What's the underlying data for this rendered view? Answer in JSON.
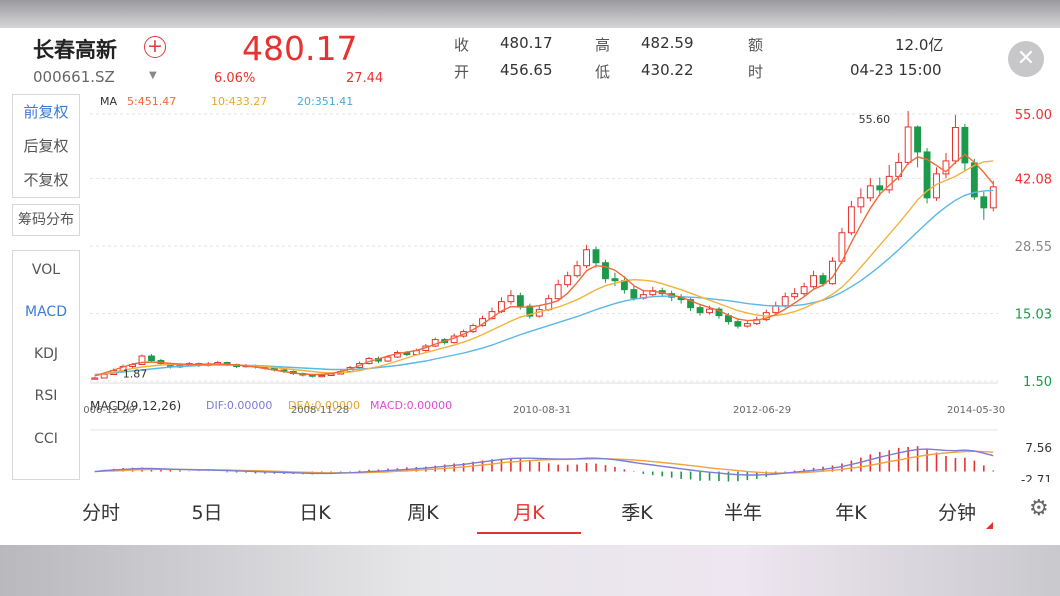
{
  "header": {
    "name": "长春高新",
    "code": "000661.SZ",
    "price": "480.17",
    "change_pct": "6.06%",
    "change_amt": "27.44",
    "quote": {
      "close_label": "收",
      "close": "480.17",
      "open_label": "开",
      "open": "456.65",
      "high_label": "高",
      "high": "482.59",
      "low_label": "低",
      "low": "430.22",
      "amount_label": "额",
      "amount": "12.0亿",
      "time_label": "时",
      "time": "04-23 15:00"
    }
  },
  "rights": [
    "前复权",
    "后复权",
    "不复权"
  ],
  "chip_label": "筹码分布",
  "indicators": [
    "VOL",
    "MACD",
    "KDJ",
    "RSI",
    "CCI"
  ],
  "ma": {
    "label": "MA",
    "ma5": "5:451.47",
    "ma10": "10:433.27",
    "ma20": "20:351.41"
  },
  "macd": {
    "label": "MACD(9,12,26)",
    "dif": "DIF:0.00000",
    "dea": "DEA:0.00000",
    "macd": "MACD:0.00000"
  },
  "tabs": [
    "分时",
    "5日",
    "日K",
    "周K",
    "月K",
    "季K",
    "半年",
    "年K",
    "分钟"
  ],
  "colors": {
    "up": "#e8322f",
    "down": "#1a9a4a",
    "ma5": "#f06a3a",
    "ma10": "#f2b23c",
    "ma20": "#5ab8e6",
    "dif": "#7b7bd8",
    "dea": "#f2a33c",
    "macd": "#e04ad8",
    "accent": "#3e7bd8"
  },
  "chart_data": {
    "type": "candlestick",
    "price_axis": {
      "labels": [
        "55.00",
        "42.08",
        "28.55",
        "15.03",
        "1.50"
      ],
      "values": [
        55.0,
        42.08,
        28.55,
        15.03,
        1.5
      ],
      "range": [
        1.5,
        55.0
      ]
    },
    "date_labels": [
      "2006-12-29",
      "2008-11-28",
      "2010-08-31",
      "2012-06-29",
      "2014-05-30"
    ],
    "max_label": "55.60",
    "min_label": "1.87",
    "macd_axis": {
      "labels": [
        "7.56",
        "-2.71"
      ],
      "values": [
        7.56,
        -2.71
      ]
    },
    "candles": [
      [
        1.9,
        2.1,
        1.8,
        2.3
      ],
      [
        2.1,
        2.8,
        2.0,
        3.0
      ],
      [
        2.8,
        3.6,
        2.7,
        4.0
      ],
      [
        3.6,
        4.4,
        3.4,
        4.8
      ],
      [
        4.4,
        4.8,
        4.1,
        5.1
      ],
      [
        4.8,
        6.5,
        4.7,
        6.8
      ],
      [
        6.5,
        5.6,
        5.2,
        6.9
      ],
      [
        5.6,
        5.0,
        4.6,
        5.9
      ],
      [
        5.0,
        4.3,
        4.0,
        5.2
      ],
      [
        4.3,
        4.6,
        4.1,
        5.0
      ],
      [
        4.6,
        5.0,
        4.4,
        5.3
      ],
      [
        5.0,
        4.6,
        4.3,
        5.2
      ],
      [
        4.6,
        4.9,
        4.4,
        5.3
      ],
      [
        4.9,
        5.2,
        4.7,
        5.5
      ],
      [
        5.2,
        4.8,
        4.5,
        5.4
      ],
      [
        4.8,
        4.4,
        4.1,
        5.0
      ],
      [
        4.4,
        4.6,
        4.2,
        4.9
      ],
      [
        4.6,
        4.3,
        4.0,
        4.8
      ],
      [
        4.3,
        4.1,
        3.8,
        4.5
      ],
      [
        4.1,
        3.7,
        3.4,
        4.3
      ],
      [
        3.7,
        3.4,
        3.1,
        3.9
      ],
      [
        3.4,
        3.0,
        2.7,
        3.6
      ],
      [
        3.0,
        2.7,
        2.4,
        3.2
      ],
      [
        2.7,
        2.5,
        2.2,
        2.9
      ],
      [
        2.5,
        2.6,
        2.3,
        2.9
      ],
      [
        2.6,
        2.9,
        2.5,
        3.1
      ],
      [
        2.9,
        3.4,
        2.8,
        3.7
      ],
      [
        3.4,
        4.2,
        3.3,
        4.5
      ],
      [
        4.2,
        5.0,
        4.0,
        5.4
      ],
      [
        5.0,
        6.0,
        4.8,
        6.3
      ],
      [
        6.0,
        5.5,
        5.1,
        6.4
      ],
      [
        5.5,
        6.3,
        5.3,
        6.7
      ],
      [
        6.3,
        7.2,
        6.1,
        7.6
      ],
      [
        7.2,
        6.8,
        6.5,
        7.5
      ],
      [
        6.8,
        7.6,
        6.6,
        8.0
      ],
      [
        7.6,
        8.5,
        7.4,
        8.9
      ],
      [
        8.5,
        9.8,
        8.3,
        10.2
      ],
      [
        9.8,
        9.2,
        8.8,
        10.1
      ],
      [
        9.2,
        10.5,
        9.0,
        11.0
      ],
      [
        10.5,
        11.4,
        10.2,
        11.8
      ],
      [
        11.4,
        12.6,
        11.1,
        13.0
      ],
      [
        12.6,
        14.0,
        12.4,
        14.6
      ],
      [
        14.0,
        15.4,
        13.8,
        16.2
      ],
      [
        15.4,
        17.4,
        15.1,
        18.3
      ],
      [
        17.4,
        18.6,
        16.8,
        19.7
      ],
      [
        18.6,
        16.5,
        15.8,
        19.2
      ],
      [
        16.5,
        14.5,
        14.0,
        17.0
      ],
      [
        14.5,
        15.8,
        14.2,
        16.5
      ],
      [
        15.8,
        18.0,
        15.5,
        18.8
      ],
      [
        18.0,
        20.8,
        17.8,
        21.8
      ],
      [
        20.8,
        22.6,
        20.3,
        23.4
      ],
      [
        22.6,
        24.6,
        22.2,
        25.6
      ],
      [
        24.6,
        27.8,
        24.1,
        28.8
      ],
      [
        27.8,
        25.2,
        24.2,
        28.4
      ],
      [
        25.2,
        22.0,
        21.2,
        25.8
      ],
      [
        22.0,
        21.6,
        20.5,
        23.2
      ],
      [
        21.6,
        19.8,
        19.0,
        22.5
      ],
      [
        19.8,
        18.1,
        17.6,
        20.5
      ],
      [
        18.1,
        18.8,
        17.8,
        19.8
      ],
      [
        18.8,
        19.6,
        18.4,
        20.4
      ],
      [
        19.6,
        19.0,
        18.3,
        20.2
      ],
      [
        19.0,
        18.3,
        17.5,
        19.6
      ],
      [
        18.3,
        17.8,
        17.0,
        18.9
      ],
      [
        17.8,
        16.2,
        15.5,
        18.3
      ],
      [
        16.2,
        15.2,
        14.6,
        16.8
      ],
      [
        15.2,
        15.9,
        14.8,
        16.6
      ],
      [
        15.9,
        14.6,
        14.0,
        16.3
      ],
      [
        14.6,
        13.4,
        12.8,
        15.1
      ],
      [
        13.4,
        12.5,
        12.0,
        13.9
      ],
      [
        12.5,
        13.0,
        12.2,
        13.6
      ],
      [
        13.0,
        13.8,
        12.7,
        14.4
      ],
      [
        13.8,
        15.2,
        13.5,
        15.8
      ],
      [
        15.2,
        16.6,
        14.9,
        17.4
      ],
      [
        16.6,
        18.4,
        16.2,
        19.2
      ],
      [
        18.4,
        19.0,
        17.8,
        20.1
      ],
      [
        19.0,
        20.4,
        18.6,
        21.2
      ],
      [
        20.4,
        22.6,
        20.0,
        23.6
      ],
      [
        22.6,
        21.0,
        20.4,
        23.2
      ],
      [
        21.0,
        25.5,
        20.8,
        26.3
      ],
      [
        25.5,
        31.2,
        25.0,
        32.2
      ],
      [
        31.2,
        36.4,
        30.7,
        37.6
      ],
      [
        36.4,
        38.2,
        35.1,
        40.1
      ],
      [
        38.2,
        40.6,
        37.5,
        42.2
      ],
      [
        40.6,
        39.8,
        38.6,
        42.3
      ],
      [
        39.8,
        42.5,
        39.1,
        44.8
      ],
      [
        42.5,
        45.3,
        41.7,
        47.2
      ],
      [
        45.3,
        52.4,
        44.8,
        55.6
      ],
      [
        52.4,
        47.4,
        44.3,
        52.7
      ],
      [
        47.4,
        38.2,
        37.1,
        48.2
      ],
      [
        38.2,
        43.0,
        37.6,
        44.3
      ],
      [
        43.0,
        45.6,
        42.1,
        47.2
      ],
      [
        45.6,
        52.3,
        45.0,
        54.8
      ],
      [
        52.3,
        45.2,
        43.7,
        53.0
      ],
      [
        45.2,
        38.4,
        37.8,
        46.0
      ],
      [
        38.4,
        36.2,
        33.8,
        39.4
      ],
      [
        36.2,
        40.4,
        35.5,
        41.6
      ]
    ],
    "ma5": [
      2.5,
      3.1,
      3.7,
      4.3,
      4.9,
      5.2,
      5.3,
      5.2,
      5.0,
      4.9,
      4.8,
      4.8,
      4.9,
      4.9,
      4.8,
      4.7,
      4.5,
      4.3,
      4.0,
      3.7,
      3.4,
      3.1,
      2.9,
      2.8,
      2.8,
      3.0,
      3.4,
      3.9,
      4.6,
      5.4,
      5.9,
      6.5,
      7.0,
      7.3,
      7.6,
      8.2,
      8.9,
      9.5,
      10.1,
      10.9,
      11.8,
      12.9,
      14.2,
      15.5,
      16.4,
      16.3,
      16.3,
      16.6,
      17.0,
      17.6,
      19.1,
      21.2,
      23.6,
      24.6,
      24.4,
      23.7,
      22.3,
      20.6,
      19.6,
      19.5,
      19.2,
      18.7,
      18.3,
      17.6,
      16.8,
      16.2,
      15.6,
      14.7,
      13.9,
      13.6,
      13.7,
      14.1,
      14.8,
      15.9,
      17.1,
      18.4,
      19.9,
      20.7,
      22.3,
      25.4,
      29.3,
      32.8,
      36.1,
      38.9,
      40.7,
      42.4,
      45.1,
      46.4,
      45.9,
      44.7,
      43.4,
      45.3,
      46.9,
      45.3,
      43.3,
      41.0
    ],
    "ma10": [
      2.6,
      2.9,
      3.3,
      3.6,
      4.0,
      4.3,
      4.5,
      4.7,
      4.8,
      4.8,
      4.8,
      4.8,
      4.8,
      4.8,
      4.8,
      4.7,
      4.6,
      4.5,
      4.4,
      4.2,
      4.0,
      3.8,
      3.6,
      3.4,
      3.2,
      3.1,
      3.2,
      3.3,
      3.6,
      4.0,
      4.4,
      4.9,
      5.5,
      6.1,
      6.7,
      7.2,
      7.7,
      8.2,
      8.7,
      9.3,
      10.0,
      10.8,
      11.7,
      12.6,
      13.5,
      14.3,
      14.8,
      15.3,
      15.8,
      16.3,
      17.0,
      17.8,
      18.8,
      19.8,
      20.6,
      21.1,
      21.6,
      21.8,
      21.7,
      21.5,
      21.0,
      20.4,
      19.8,
      19.1,
      18.4,
      17.7,
      17.0,
      16.3,
      15.6,
      15.1,
      14.7,
      14.5,
      14.6,
      14.9,
      15.4,
      16.1,
      17.0,
      17.8,
      18.9,
      20.3,
      22.2,
      24.3,
      26.5,
      28.7,
      30.9,
      33.1,
      35.4,
      37.8,
      39.6,
      40.9,
      41.7,
      42.5,
      43.6,
      44.7,
      45.4,
      45.6
    ],
    "ma20": [
      2.8,
      2.9,
      3.1,
      3.3,
      3.5,
      3.7,
      3.9,
      4.1,
      4.3,
      4.4,
      4.5,
      4.6,
      4.7,
      4.7,
      4.7,
      4.7,
      4.6,
      4.6,
      4.5,
      4.4,
      4.3,
      4.2,
      4.1,
      4.0,
      3.9,
      3.8,
      3.8,
      3.8,
      3.9,
      4.0,
      4.2,
      4.4,
      4.6,
      4.9,
      5.2,
      5.5,
      5.9,
      6.3,
      6.7,
      7.1,
      7.6,
      8.1,
      8.7,
      9.4,
      10.1,
      10.8,
      11.4,
      12.0,
      12.6,
      13.2,
      13.8,
      14.4,
      15.1,
      15.8,
      16.4,
      17.0,
      17.5,
      17.9,
      18.2,
      18.4,
      18.5,
      18.5,
      18.4,
      18.3,
      18.2,
      18.0,
      17.8,
      17.6,
      17.3,
      17.0,
      16.8,
      16.6,
      16.5,
      16.5,
      16.6,
      16.8,
      17.2,
      17.7,
      18.4,
      19.3,
      20.4,
      21.6,
      23.0,
      24.5,
      26.1,
      27.8,
      29.6,
      31.4,
      33.2,
      34.9,
      36.4,
      37.7,
      38.7,
      39.3,
      39.6,
      39.7
    ],
    "dif": [
      0.0,
      0.3,
      0.5,
      0.7,
      0.9,
      1.0,
      1.0,
      0.9,
      0.8,
      0.7,
      0.6,
      0.5,
      0.5,
      0.4,
      0.3,
      0.2,
      0.1,
      0.0,
      -0.1,
      -0.2,
      -0.3,
      -0.4,
      -0.5,
      -0.6,
      -0.6,
      -0.6,
      -0.5,
      -0.4,
      -0.2,
      0.0,
      0.1,
      0.3,
      0.5,
      0.7,
      0.9,
      1.1,
      1.4,
      1.7,
      2.0,
      2.3,
      2.7,
      3.1,
      3.5,
      3.9,
      4.2,
      4.3,
      4.3,
      4.2,
      4.1,
      4.0,
      4.0,
      4.1,
      4.3,
      4.3,
      4.1,
      3.8,
      3.4,
      2.9,
      2.5,
      2.1,
      1.7,
      1.3,
      0.9,
      0.5,
      0.1,
      -0.2,
      -0.5,
      -0.8,
      -1.0,
      -1.1,
      -1.1,
      -1.0,
      -0.8,
      -0.5,
      -0.2,
      0.1,
      0.4,
      0.7,
      1.1,
      1.6,
      2.3,
      3.0,
      3.8,
      4.6,
      5.3,
      6.0,
      6.6,
      7.1,
      7.2,
      7.0,
      6.8,
      6.7,
      6.9,
      6.6,
      5.9,
      5.1
    ],
    "dea": [
      0.0,
      0.1,
      0.2,
      0.3,
      0.5,
      0.6,
      0.7,
      0.7,
      0.7,
      0.7,
      0.7,
      0.6,
      0.6,
      0.5,
      0.5,
      0.4,
      0.3,
      0.3,
      0.2,
      0.1,
      0.0,
      -0.1,
      -0.2,
      -0.3,
      -0.4,
      -0.4,
      -0.4,
      -0.4,
      -0.4,
      -0.3,
      -0.2,
      -0.1,
      0.1,
      0.2,
      0.4,
      0.6,
      0.8,
      1.0,
      1.2,
      1.5,
      1.8,
      2.1,
      2.4,
      2.8,
      3.1,
      3.3,
      3.5,
      3.7,
      3.8,
      3.9,
      3.9,
      4.0,
      4.0,
      4.1,
      4.1,
      4.0,
      3.9,
      3.7,
      3.5,
      3.2,
      2.9,
      2.6,
      2.3,
      1.9,
      1.6,
      1.2,
      0.9,
      0.6,
      0.3,
      0.0,
      -0.2,
      -0.4,
      -0.5,
      -0.5,
      -0.4,
      -0.3,
      -0.1,
      0.1,
      0.4,
      0.7,
      1.1,
      1.5,
      2.0,
      2.6,
      3.2,
      3.7,
      4.3,
      4.8,
      5.3,
      5.7,
      6.0,
      6.2,
      6.4,
      6.5,
      6.4,
      6.2
    ]
  }
}
